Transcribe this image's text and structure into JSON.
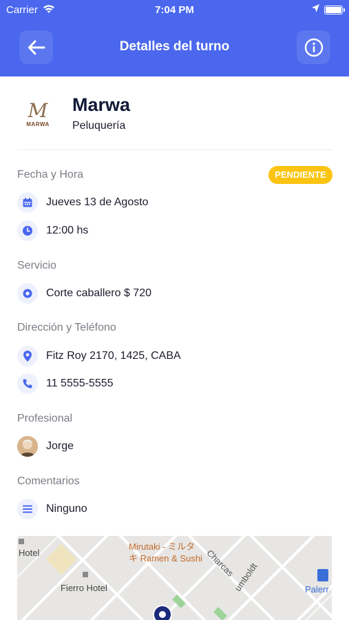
{
  "status_bar": {
    "carrier": "Carrier",
    "time": "7:04 PM"
  },
  "nav": {
    "title": "Detalles del turno",
    "back_icon": "arrow-left-icon",
    "info_icon": "info-icon"
  },
  "business": {
    "logo_letter": "M",
    "logo_word": "MARWA",
    "name": "Marwa",
    "category": "Peluquería"
  },
  "sections": {
    "datetime": {
      "label": "Fecha y Hora",
      "status": "PENDIENTE",
      "date": "Jueves 13 de Agosto",
      "time": "12:00 hs"
    },
    "service": {
      "label": "Servicio",
      "value": "Corte caballero $ 720"
    },
    "contact": {
      "label": "Dirección y Teléfono",
      "address": "Fitz Roy 2170, 1425, CABA",
      "phone": "11 5555-5555"
    },
    "professional": {
      "label": "Profesional",
      "name": "Jorge"
    },
    "comments": {
      "label": "Comentarios",
      "value": "Ninguno"
    }
  },
  "map": {
    "labels": {
      "hotel": "Hotel",
      "fierro": "Fierro Hotel",
      "mirutaki_1": "Mirutaki - ミルタ",
      "mirutaki_2": "キ Ramen & Sushi",
      "charcas": "Charcas",
      "humboldt": "umboldt",
      "palermo": "Palerr"
    }
  },
  "colors": {
    "header": "#4a67ee",
    "accent": "#4a67ee",
    "badge": "#fbc410"
  }
}
